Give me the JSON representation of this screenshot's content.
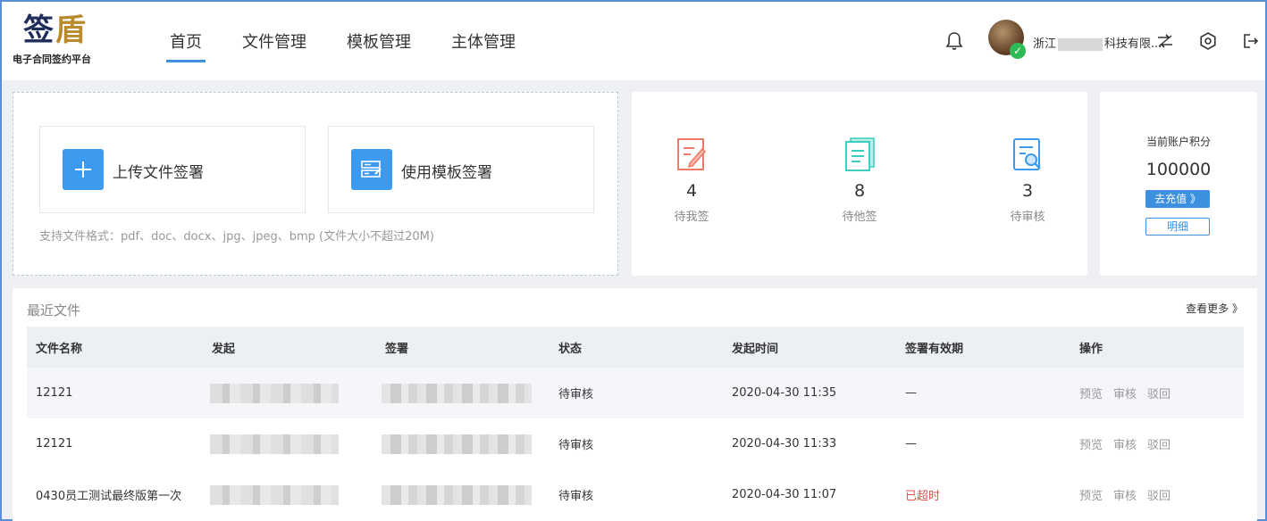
{
  "header": {
    "logo_main_a": "签",
    "logo_main_b": "盾",
    "logo_sub": "电子合同签约平台",
    "nav": [
      "首页",
      "文件管理",
      "模板管理",
      "主体管理"
    ],
    "company_prefix": "浙江",
    "company_suffix": "科技有限..."
  },
  "upload": {
    "upload_label": "上传文件签署",
    "template_label": "使用模板签署",
    "hint": "支持文件格式：pdf、doc、docx、jpg、jpeg、bmp (文件大小不超过20M)"
  },
  "stats": [
    {
      "count": "4",
      "label": "待我签"
    },
    {
      "count": "8",
      "label": "待他签"
    },
    {
      "count": "3",
      "label": "待审核"
    }
  ],
  "points": {
    "title": "当前账户积分",
    "value": "100000",
    "recharge": "去充值 》",
    "detail": "明细"
  },
  "recent": {
    "title": "最近文件",
    "more": "查看更多 》",
    "columns": [
      "文件名称",
      "发起",
      "签署",
      "状态",
      "发起时间",
      "签署有效期",
      "操作"
    ],
    "rows": [
      {
        "name": "12121",
        "status": "待审核",
        "time": "2020-04-30 11:35",
        "validity": "—"
      },
      {
        "name": "12121",
        "status": "待审核",
        "time": "2020-04-30 11:33",
        "validity": "—"
      },
      {
        "name": "0430员工测试最终版第一次",
        "status": "待审核",
        "time": "2020-04-30 11:07",
        "validity": "已超时"
      }
    ],
    "ops": [
      "预览",
      "审核",
      "驳回"
    ]
  },
  "colors": {
    "accent": "#3d8fe0",
    "expired": "#d9534f",
    "verified": "#2dbb55"
  }
}
